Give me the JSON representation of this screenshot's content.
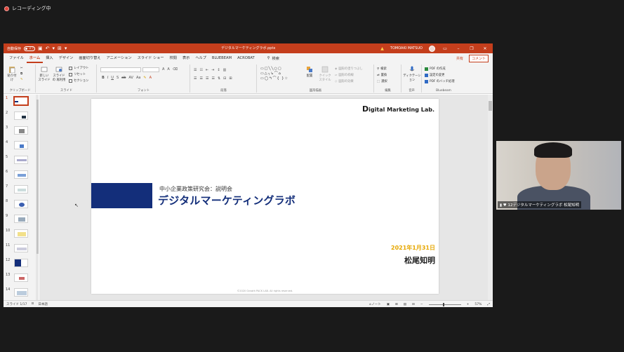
{
  "recording": {
    "label": "レコーディング中"
  },
  "window": {
    "autosave_label": "自動保存",
    "autosave_state": "オフ",
    "file_title": "デジタルマーケティングラボ.pptx",
    "user_name": "TOMOAKI MATSUO",
    "min": "–",
    "restore": "❐",
    "close": "✕"
  },
  "menu": {
    "items": [
      "ファイル",
      "ホーム",
      "挿入",
      "デザイン",
      "画面切り替え",
      "アニメーション",
      "スライド ショー",
      "校閲",
      "表示",
      "ヘルプ",
      "BLUEBEAM",
      "ACROBAT"
    ],
    "search": "検索",
    "share": "共有",
    "comment": "コメント"
  },
  "ribbon": {
    "clipboard": {
      "paste": "貼り付け",
      "label": "クリップボード"
    },
    "slides": {
      "new_slide": "新しい スライド",
      "reuse": "スライドの 再利用",
      "layout": "レイアウト",
      "reset": "リセット",
      "section": "セクション",
      "label": "スライド"
    },
    "font": {
      "label": "フォント"
    },
    "paragraph": {
      "label": "段落"
    },
    "drawing": {
      "arrange": "配置",
      "quick_styles": "クイック スタイル",
      "fill": "図形の塗りつぶし",
      "outline": "図形の枠線",
      "effects": "図形の効果",
      "label": "図形描画"
    },
    "editing": {
      "find": "検索",
      "replace": "置換",
      "select": "選択",
      "label": "編集"
    },
    "voice": {
      "dictate": "ディクテーション",
      "label": "音声"
    },
    "bluebeam": {
      "create_pdf": "PDF の作成",
      "settings": "設定の変更",
      "batch": "PDF のバッチ処理",
      "label": "Bluebeam"
    }
  },
  "thumbnails": {
    "numbers": [
      "1",
      "2",
      "3",
      "4",
      "5",
      "6",
      "7",
      "8",
      "9",
      "10",
      "11",
      "12",
      "13",
      "14"
    ],
    "selected": "1"
  },
  "slide": {
    "brand_first": "D",
    "brand_rest": "igital Marketing Lab.",
    "subtitle": "中小企業政策研究会：説明会",
    "title": "デジタルマーケティングラボ",
    "date": "2021年1月31日",
    "presenter": "松尾知明",
    "copyright": "©2020 Growth PACK LAB. All rights reserved."
  },
  "status": {
    "slide_count": "スライド 1/17",
    "language": "日本語",
    "notes": "ノート",
    "zoom": "57%"
  },
  "webcam": {
    "label": "12デジタルマーケティングラボ 松尾知明"
  },
  "colors": {
    "ppt_accent": "#c43e1c",
    "title_navy": "#132e7a",
    "date_gold": "#e6a700"
  }
}
